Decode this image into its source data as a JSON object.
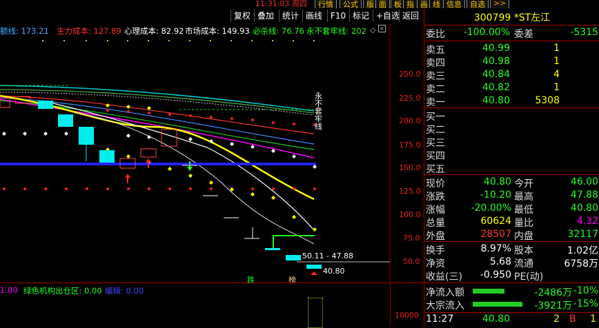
{
  "topbar": {
    "clock": "11:31:03 周四",
    "menus": [
      "行情",
      "公式",
      "版",
      "面",
      "板",
      "指",
      "画",
      "线",
      "信息",
      "自选",
      ">>"
    ]
  },
  "toolbar": {
    "buttons": [
      "复权",
      "叠加",
      "统计",
      "画线",
      "F10",
      "标记",
      "+自选",
      "返回"
    ]
  },
  "legend": {
    "items": [
      {
        "text": "额线: 173.21",
        "color": "#4af"
      },
      {
        "text": "主力成本: 127.89",
        "color": "#f33"
      },
      {
        "text": "心理成本: 82.92",
        "color": "#fff"
      },
      {
        "text": "市场成本: 149.93",
        "color": "#fff"
      },
      {
        "text": "必杀线: 76.76",
        "color": "#2f2"
      },
      {
        "text": "永不套牢线: 202",
        "color": "#2f2"
      }
    ]
  },
  "chart": {
    "y_ticks": [
      "250.0",
      "225.0",
      "200.0",
      "175.0",
      "150.0",
      "125.0",
      "100.0",
      "75.0",
      "50.0"
    ],
    "annotation_vertical": "永不套牢线",
    "range_label": "50.11 - 47.88",
    "last_price_label": "40.80",
    "marker_sell": "跌",
    "marker_bang": "榜"
  },
  "subpanel": {
    "items": [
      {
        "text": "1.00",
        "color": "#f0f"
      },
      {
        "text": "绿色机构出仓区: 0.00",
        "color": "#2f2"
      },
      {
        "text": "编辑: 0.00",
        "color": "#44f"
      }
    ],
    "y_tick": "10000"
  },
  "quote": {
    "code": "300799",
    "name": "*ST左江",
    "weibi_label": "委比",
    "weibi": "-100.00%",
    "weicha_label": "委差",
    "weicha": "-5315",
    "asks": [
      {
        "label": "卖五",
        "price": "40.99",
        "vol": "1"
      },
      {
        "label": "卖四",
        "price": "40.98",
        "vol": "1"
      },
      {
        "label": "卖三",
        "price": "40.84",
        "vol": "4"
      },
      {
        "label": "卖二",
        "price": "40.82",
        "vol": "1"
      },
      {
        "label": "卖一",
        "price": "40.80",
        "vol": "5308"
      }
    ],
    "bids": [
      {
        "label": "买一"
      },
      {
        "label": "买二"
      },
      {
        "label": "买三"
      },
      {
        "label": "买四"
      },
      {
        "label": "买五"
      }
    ],
    "stats": [
      {
        "l1": "现价",
        "v1": "40.80",
        "c1": "g",
        "l2": "今开",
        "v2": "46.00",
        "c2": "g"
      },
      {
        "l1": "涨跌",
        "v1": "-10.20",
        "c1": "g",
        "l2": "最高",
        "v2": "47.88",
        "c2": "g"
      },
      {
        "l1": "涨幅",
        "v1": "-20.00%",
        "c1": "g",
        "l2": "最低",
        "v2": "40.80",
        "c2": "g"
      },
      {
        "l1": "总量",
        "v1": "60624",
        "c1": "y",
        "l2": "量比",
        "v2": "4.32",
        "c2": "m"
      },
      {
        "l1": "外盘",
        "v1": "28507",
        "c1": "r",
        "l2": "内盘",
        "v2": "32117",
        "c2": "g"
      }
    ],
    "stats2": [
      {
        "l1": "换手",
        "v1": "8.97%",
        "c1": "w",
        "l2": "股本",
        "v2": "1.02亿",
        "c2": "w"
      },
      {
        "l1": "净资",
        "v1": "5.68",
        "c1": "w",
        "l2": "流通",
        "v2": "6758万",
        "c2": "w"
      },
      {
        "l1": "收益(三)",
        "v1": "-0.950",
        "c1": "w",
        "l2": "PE(动)",
        "v2": "",
        "c2": "w"
      }
    ],
    "flows": [
      {
        "label": "净流入额",
        "value": "-2486万",
        "pct": "-10%"
      },
      {
        "label": "大宗流入",
        "value": "-3921万",
        "pct": "-15%"
      }
    ],
    "tick": {
      "time": "11:27",
      "price": "40.80",
      "vol": "2",
      "side": "B",
      "num": "1"
    }
  }
}
